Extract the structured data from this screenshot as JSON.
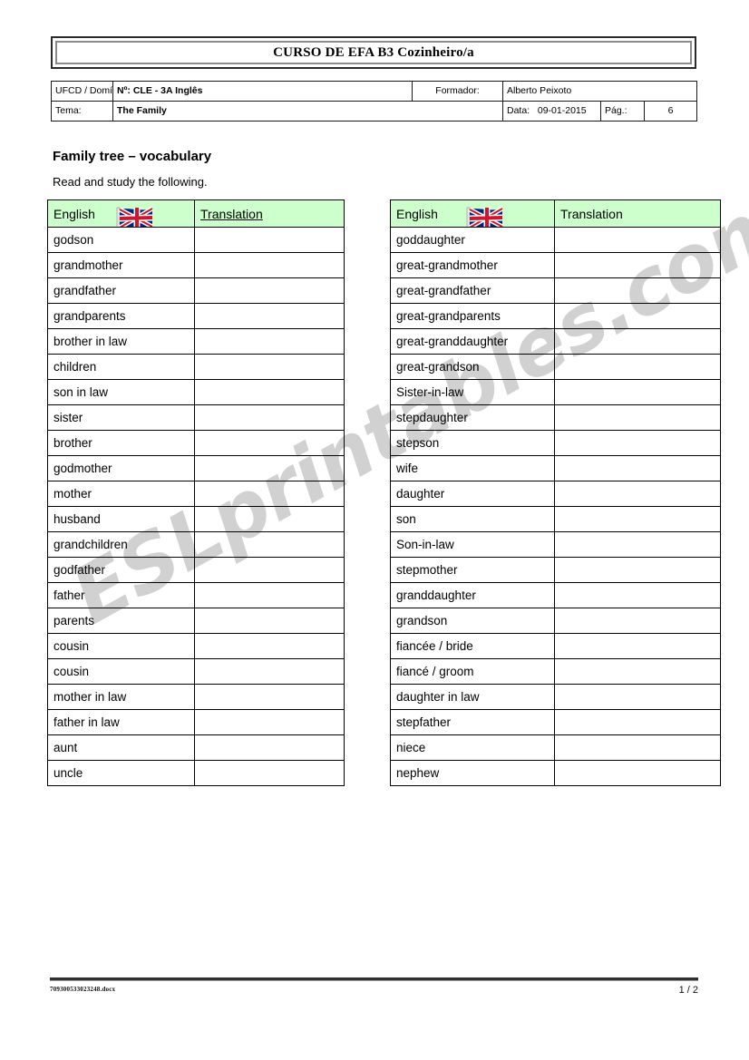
{
  "document": {
    "title": "CURSO DE EFA B3 Cozinheiro/a",
    "meta": {
      "ufcd_label": "UFCD / Domínio:",
      "ufcd_value": "Nº: CLE - 3A    Inglês",
      "formador_label": "Formador:",
      "formador_value": "Alberto Peixoto",
      "tema_label": "Tema:",
      "tema_value": "The Family",
      "data_label": "Data:",
      "data_value": "09-01-2015",
      "pag_label": "Pág.:",
      "pag_value": "6"
    }
  },
  "section": {
    "heading": "Family tree – vocabulary",
    "instruction": "Read and study the following."
  },
  "watermark": {
    "text": "ESLprintables.com"
  },
  "colors": {
    "header_green": "#ccffcc",
    "border": "#000000",
    "title_border_outer": "#2b2b2b",
    "title_border_inner": "#8a8a8a",
    "watermark_gray": "#c9c9c9"
  },
  "tables": {
    "left": {
      "columns": [
        "English",
        "Translation"
      ],
      "header_underline": [
        false,
        true
      ],
      "flag_icon": "uk-flag-icon",
      "rows": [
        {
          "english": "godson",
          "translation": ""
        },
        {
          "english": "grandmother",
          "translation": ""
        },
        {
          "english": "grandfather",
          "translation": ""
        },
        {
          "english": "grandparents",
          "translation": ""
        },
        {
          "english": "brother in law",
          "translation": ""
        },
        {
          "english": "children",
          "translation": ""
        },
        {
          "english": "son in law",
          "translation": ""
        },
        {
          "english": "sister",
          "translation": ""
        },
        {
          "english": "brother",
          "translation": ""
        },
        {
          "english": "godmother",
          "translation": ""
        },
        {
          "english": "mother",
          "translation": ""
        },
        {
          "english": "husband",
          "translation": ""
        },
        {
          "english": "grandchildren",
          "translation": ""
        },
        {
          "english": "godfather",
          "translation": ""
        },
        {
          "english": "father",
          "translation": ""
        },
        {
          "english": "parents",
          "translation": ""
        },
        {
          "english": "cousin",
          "translation": ""
        },
        {
          "english": "cousin",
          "translation": ""
        },
        {
          "english": "mother in law",
          "translation": ""
        },
        {
          "english": "father in law",
          "translation": ""
        },
        {
          "english": "aunt",
          "translation": ""
        },
        {
          "english": "uncle",
          "translation": ""
        }
      ]
    },
    "right": {
      "columns": [
        "English",
        "Translation"
      ],
      "header_underline": [
        false,
        false
      ],
      "flag_icon": "uk-flag-icon",
      "rows": [
        {
          "english": "goddaughter",
          "translation": ""
        },
        {
          "english": "great-grandmother",
          "translation": ""
        },
        {
          "english": "great-grandfather",
          "translation": ""
        },
        {
          "english": "great-grandparents",
          "translation": ""
        },
        {
          "english": "great-granddaughter",
          "translation": ""
        },
        {
          "english": "great-grandson",
          "translation": ""
        },
        {
          "english": "Sister-in-law",
          "translation": ""
        },
        {
          "english": "stepdaughter",
          "translation": ""
        },
        {
          "english": "stepson",
          "translation": ""
        },
        {
          "english": "wife",
          "translation": ""
        },
        {
          "english": "daughter",
          "translation": ""
        },
        {
          "english": "son",
          "translation": ""
        },
        {
          "english": "Son-in-law",
          "translation": ""
        },
        {
          "english": "stepmother",
          "translation": ""
        },
        {
          "english": "granddaughter",
          "translation": ""
        },
        {
          "english": "grandson",
          "translation": ""
        },
        {
          "english": "fiancée / bride",
          "translation": ""
        },
        {
          "english": "fiancé / groom",
          "translation": ""
        },
        {
          "english": "daughter in law",
          "translation": ""
        },
        {
          "english": "stepfather",
          "translation": ""
        },
        {
          "english": "niece",
          "translation": ""
        },
        {
          "english": "nephew",
          "translation": ""
        }
      ]
    }
  },
  "footer": {
    "filename": "709300533023248.docx",
    "page": "1 / 2"
  }
}
